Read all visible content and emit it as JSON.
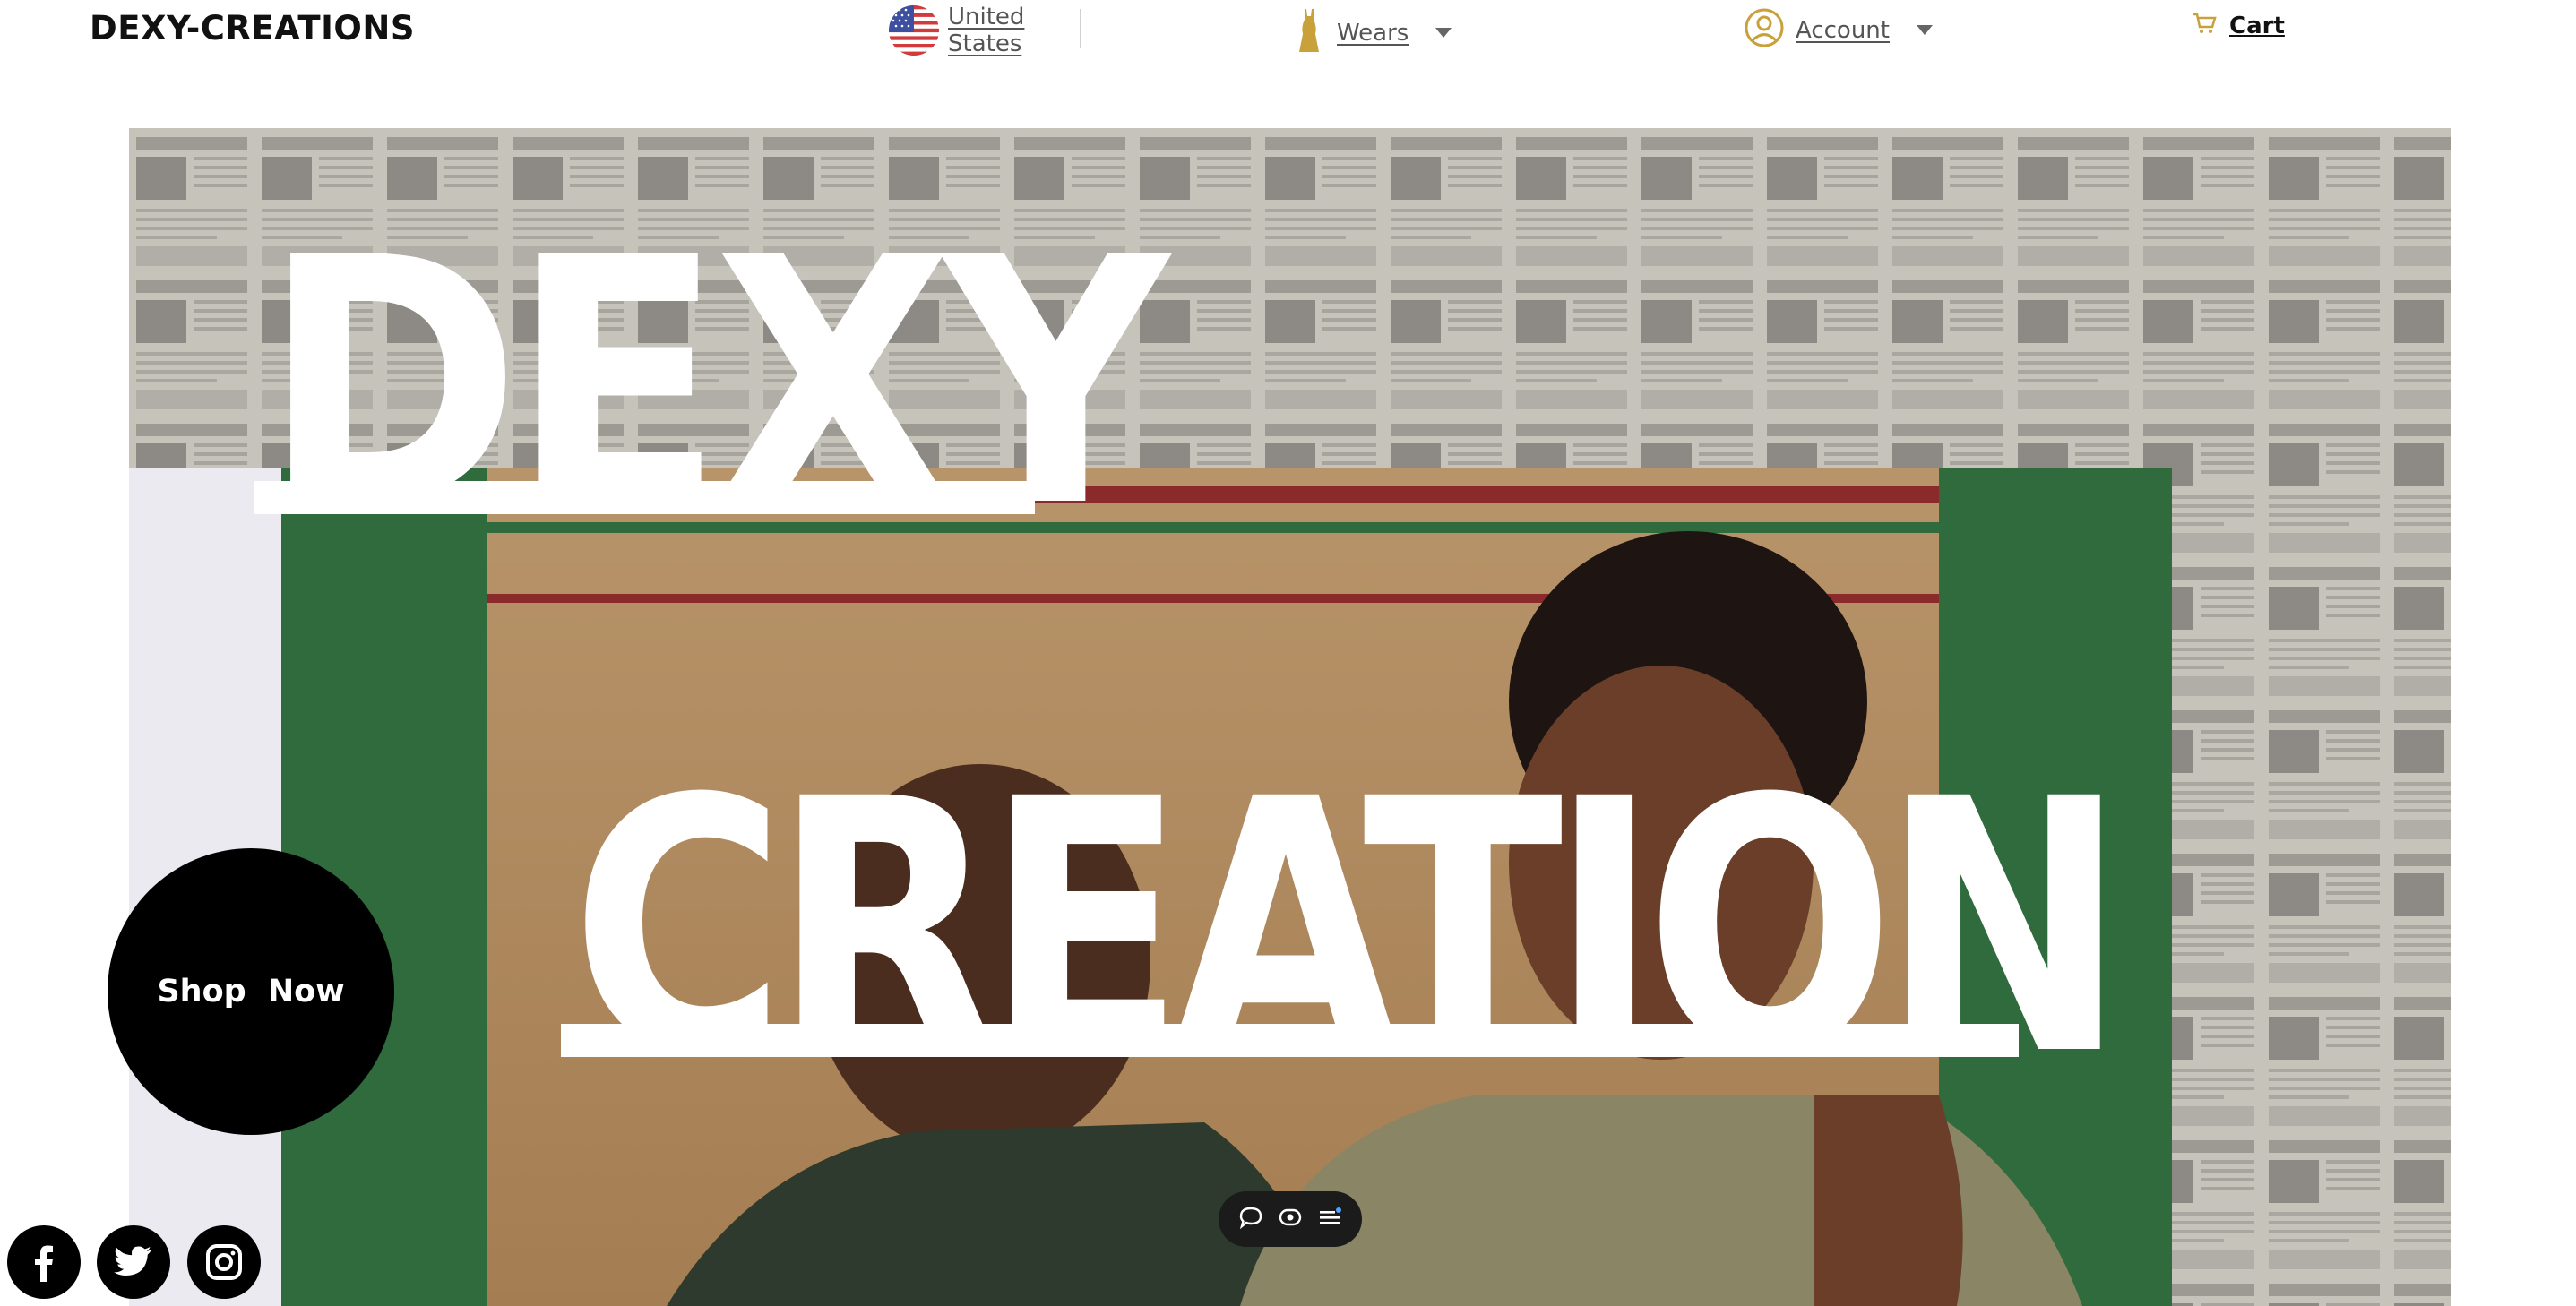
{
  "header": {
    "brand": "DEXY-CREATIONS",
    "country": {
      "line1": "United",
      "line2": "States",
      "icon": "us-flag-icon"
    },
    "wears": {
      "label": "Wears",
      "icon": "dress-icon"
    },
    "account": {
      "label": "Account",
      "icon": "user-circle-icon"
    },
    "cart": {
      "label": "Cart",
      "icon": "cart-icon"
    }
  },
  "hero": {
    "word1": "DEXY",
    "word2": "CREATION",
    "cta": "Shop Now"
  },
  "social": [
    "facebook-icon",
    "twitter-icon",
    "instagram-icon"
  ],
  "toolbar": [
    "comment-icon",
    "eye-icon",
    "menu-icon"
  ],
  "colors": {
    "accent": "#c9a13b",
    "black": "#000000",
    "white": "#ffffff"
  }
}
